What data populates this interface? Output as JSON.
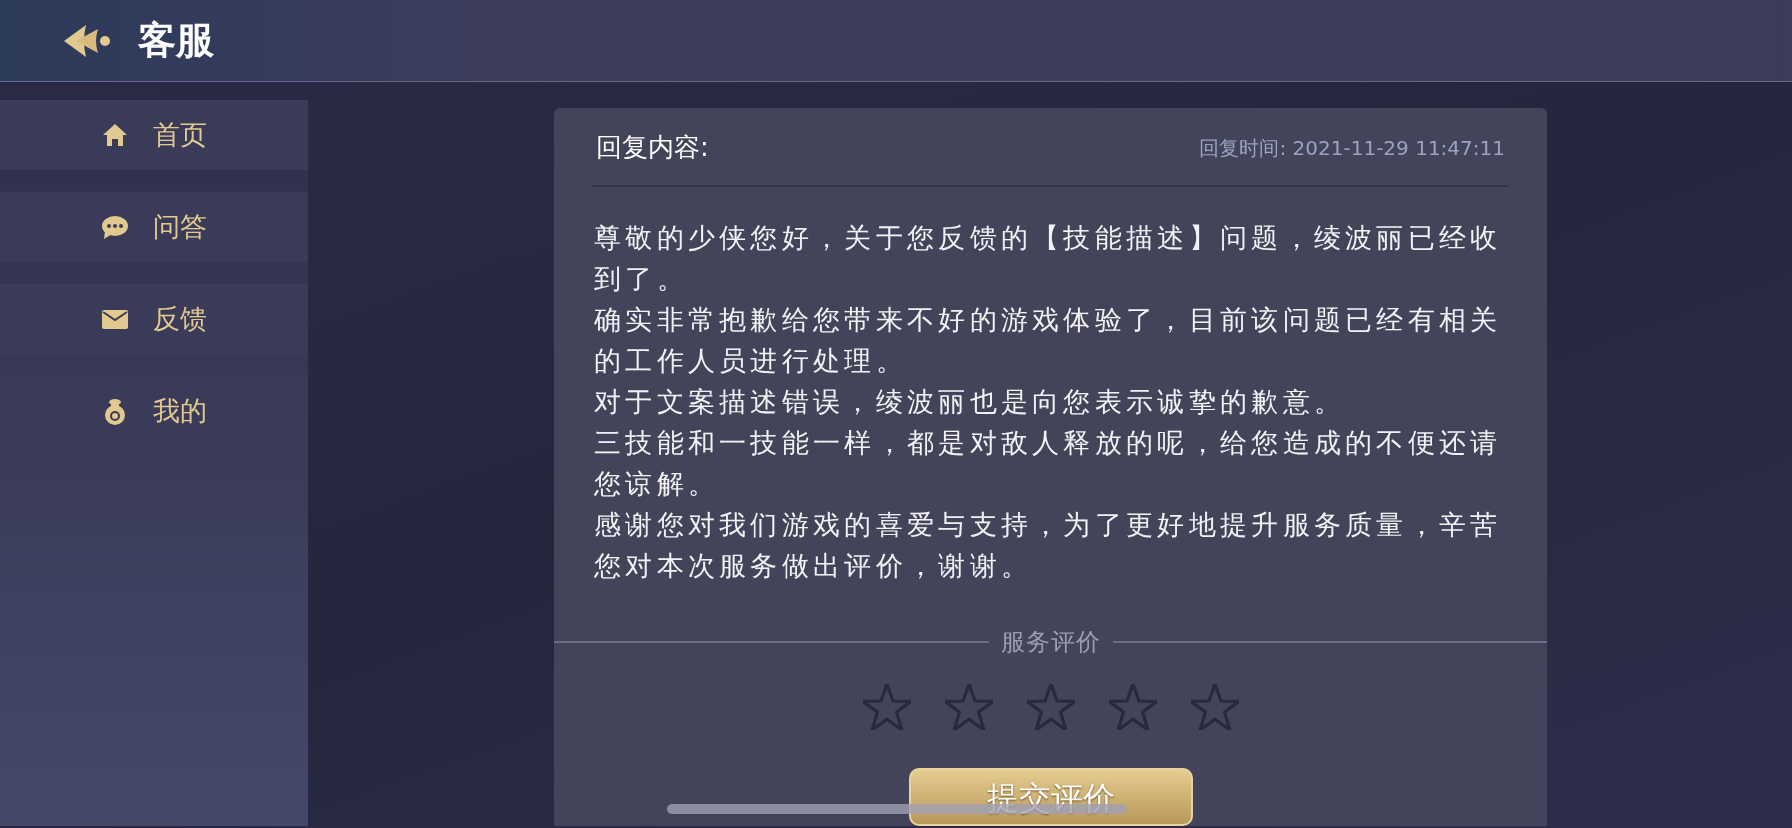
{
  "header": {
    "title": "客服"
  },
  "sidebar": {
    "items": [
      {
        "label": "首页",
        "kind": "home"
      },
      {
        "label": "问答",
        "kind": "chat"
      },
      {
        "label": "反馈",
        "kind": "mail"
      },
      {
        "label": "我的",
        "kind": "bag"
      }
    ]
  },
  "reply": {
    "heading": "回复内容:",
    "time": "回复时间: 2021-11-29 11:47:11",
    "paragraphs": [
      "尊敬的少侠您好，关于您反馈的【技能描述】问题，绫波丽已经收到了。",
      "确实非常抱歉给您带来不好的游戏体验了，目前该问题已经有相关的工作人员进行处理。",
      "对于文案描述错误，绫波丽也是向您表示诚挚的歉意。",
      "三技能和一技能一样，都是对敌人释放的呢，给您造成的不便还请您谅解。",
      "感谢您对我们游戏的喜爱与支持，为了更好地提升服务质量，辛苦您对本次服务做出评价，谢谢。"
    ]
  },
  "rating": {
    "label": "服务评价",
    "stars": 0,
    "submit": "提交评价"
  }
}
